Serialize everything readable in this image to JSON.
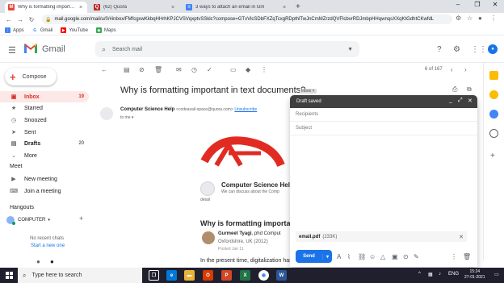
{
  "browser": {
    "tabs": [
      {
        "title": "Why is formatting important in te",
        "favicon": "gmail-icon",
        "active": true
      },
      {
        "title": "(62) Quora",
        "favicon": "quora-icon",
        "active": false
      },
      {
        "title": "3 ways to attach an email in Gm",
        "favicon": "docs-icon",
        "active": false
      }
    ],
    "url": "mail.google.com/mail/u/0/#inbox/FMfcgxwKkbqHHrhKPJCVSVqxptvSSklc?compose=GTvVlcSDbFXZqTcxgRDpthlTwJnCmMZrzdQVFlcbvrRDJmbpHHqwnqsXXqKtGdhtCKwfdL",
    "bookmarks": [
      {
        "label": "Apps",
        "icon": "apps-grid-icon"
      },
      {
        "label": "Gmail",
        "icon": "google-icon"
      },
      {
        "label": "YouTube",
        "icon": "youtube-icon"
      },
      {
        "label": "Maps",
        "icon": "maps-icon"
      }
    ]
  },
  "gmail": {
    "brand": "Gmail",
    "search_placeholder": "Search mail",
    "compose_label": "Compose",
    "nav": [
      {
        "label": "Inbox",
        "icon": "inbox-icon",
        "count": "19",
        "active": true
      },
      {
        "label": "Starred",
        "icon": "star-icon",
        "count": "",
        "active": false
      },
      {
        "label": "Snoozed",
        "icon": "clock-icon",
        "count": "",
        "active": false
      },
      {
        "label": "Sent",
        "icon": "send-icon",
        "count": "",
        "active": false
      },
      {
        "label": "Drafts",
        "icon": "draft-icon",
        "count": "20",
        "active": false
      },
      {
        "label": "More",
        "icon": "chevron-down-icon",
        "count": "",
        "active": false
      }
    ],
    "meet": {
      "title": "Meet",
      "items": [
        {
          "label": "New meeting",
          "icon": "video-icon"
        },
        {
          "label": "Join a meeting",
          "icon": "keyboard-icon"
        }
      ]
    },
    "hangouts": {
      "title": "Hangouts",
      "user": "COMPUTER",
      "no_chats": "No recent chats",
      "start_new": "Start a new one"
    },
    "pager": "6 of 167"
  },
  "email": {
    "subject": "Why is formatting important in text documents?",
    "label_chip": "Inbox ×",
    "sender_name": "Computer Science Help",
    "sender_address": "<codeavail-space@quora.com>",
    "unsubscribe": "Unsubscribe",
    "to_me": "to me ▾",
    "card_title": "Computer Science Help",
    "card_desc": "We can discuss about the Comp",
    "card_desc2": "detail",
    "question_heading": "Why is formatting important",
    "author_name": "Gurmeet Tyagi",
    "author_suffix": ", phd Comput",
    "author_location": "Oxfordshire, UK (2012)",
    "posted": "Posted Jan 11",
    "body_start": "In the present time, digitalization has"
  },
  "draft": {
    "title": "Draft saved",
    "recipients_placeholder": "Recipients",
    "subject_placeholder": "Subject",
    "attachment_name": "email.pdf",
    "attachment_size": "(233K)",
    "send_label": "Send"
  },
  "taskbar": {
    "search_placeholder": "Type here to search",
    "language": "ENG",
    "time": "15:24",
    "date": "27-01-2021"
  },
  "colors": {
    "gmail_red": "#d93025",
    "inbox_highlight": "#fce8e6",
    "send_blue": "#1a73e8",
    "draft_header": "#404040",
    "taskbar": "#1f1f2e"
  }
}
